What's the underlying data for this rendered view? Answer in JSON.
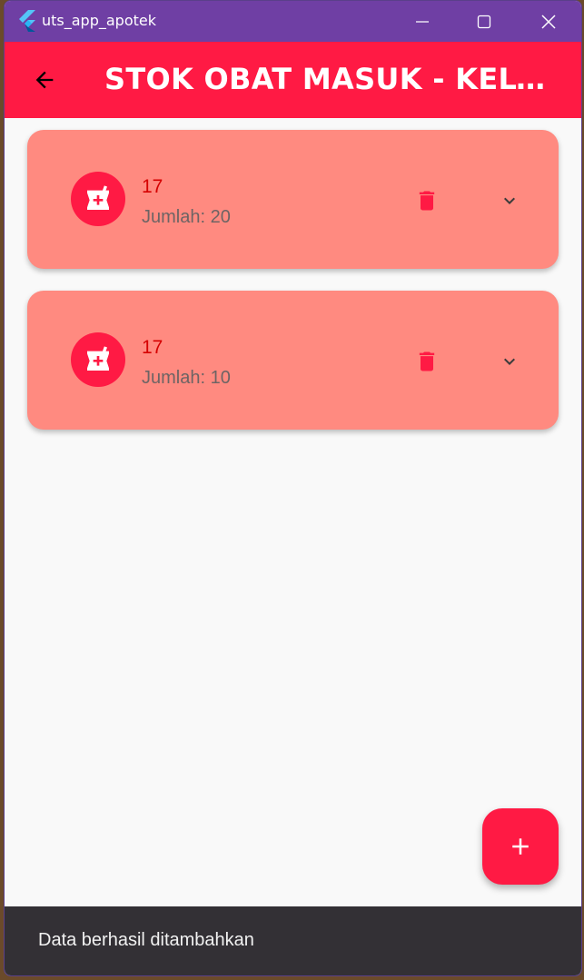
{
  "window": {
    "title": "uts_app_apotek",
    "controls": {
      "minimize_icon": "minimize-icon",
      "maximize_icon": "maximize-icon",
      "close_icon": "close-icon"
    }
  },
  "appbar": {
    "title": "STOK OBAT MASUK - KELU...",
    "back_icon": "arrow-back-icon",
    "color": "#ff1a44"
  },
  "items": [
    {
      "title": "17",
      "subtitle": "Jumlah: 20",
      "icon": "pharmacy-mortar-icon",
      "delete_icon": "trash-icon",
      "expand_icon": "chevron-down-icon"
    },
    {
      "title": "17",
      "subtitle": "Jumlah: 10",
      "icon": "pharmacy-mortar-icon",
      "delete_icon": "trash-icon",
      "expand_icon": "chevron-down-icon"
    }
  ],
  "fab": {
    "icon": "plus-icon"
  },
  "snackbar": {
    "message": "Data berhasil ditambahkan"
  },
  "colors": {
    "accent": "#ff1a44",
    "card": "#ff8a80",
    "title_text": "#d50000",
    "titlebar": "#6f3fa4",
    "snackbar": "#333035"
  }
}
